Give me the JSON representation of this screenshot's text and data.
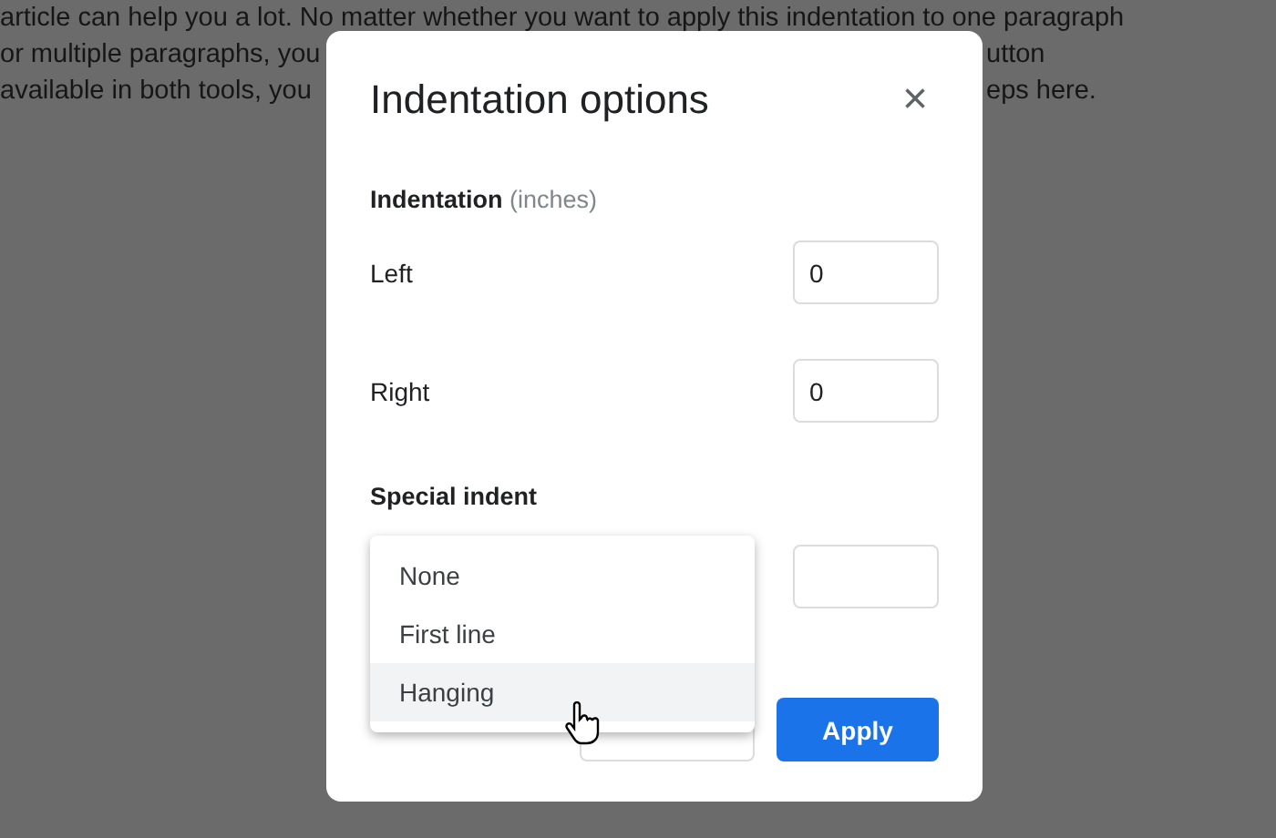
{
  "background_text": [
    {
      "left": "article can help you a lot. No matter whether you want to apply this indentation to one paragraph"
    },
    {
      "left": "or multiple paragraphs, you",
      "right": "utton"
    },
    {
      "left": "available in both tools, you",
      "right": "eps here."
    }
  ],
  "dialog": {
    "title": "Indentation options",
    "close": "×",
    "section": {
      "label": "Indentation",
      "hint": "(inches)"
    },
    "fields": [
      {
        "label": "Left",
        "value": "0"
      },
      {
        "label": "Right",
        "value": "0"
      }
    ],
    "special_indent": {
      "label": "Special indent",
      "menu": [
        {
          "label": "None",
          "selected": false
        },
        {
          "label": "First line",
          "selected": false
        },
        {
          "label": "Hanging",
          "selected": true
        }
      ]
    },
    "buttons": [
      {
        "kind": "secondary"
      },
      {
        "kind": "primary",
        "label": "Apply"
      }
    ]
  }
}
